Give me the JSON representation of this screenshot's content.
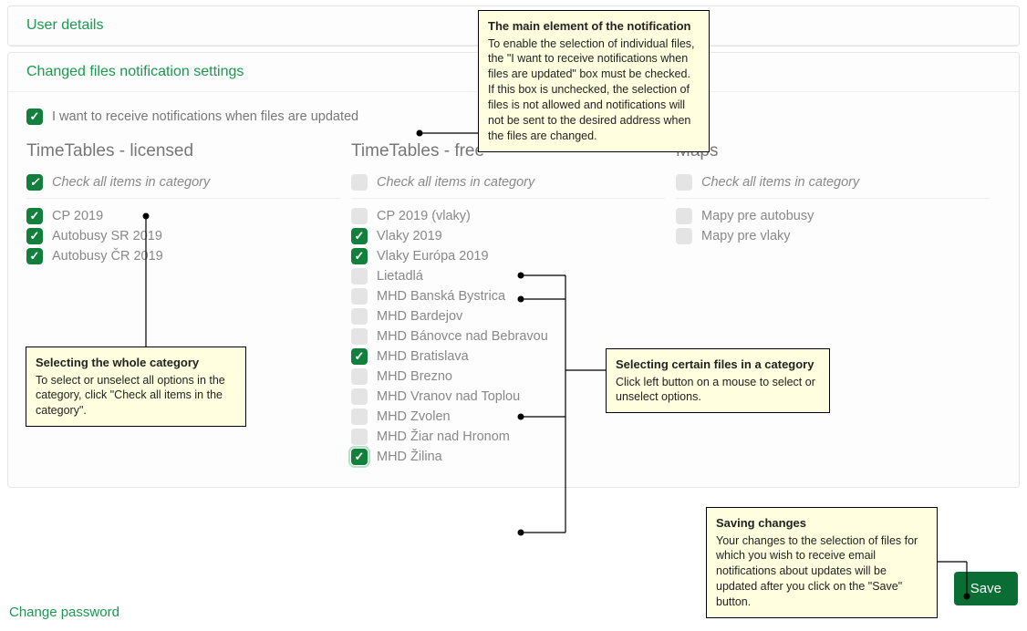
{
  "userDetails": {
    "title": "User details"
  },
  "settings": {
    "title": "Changed files notification settings",
    "mainCheckbox": {
      "label": "I want to receive notifications when files are updated",
      "checked": true
    }
  },
  "checkAllLabel": "Check all items in category",
  "columns": [
    {
      "title": "TimeTables - licensed",
      "checkAll": true,
      "items": [
        {
          "label": "CP 2019",
          "checked": true
        },
        {
          "label": "Autobusy SR 2019",
          "checked": true
        },
        {
          "label": "Autobusy ČR 2019",
          "checked": true
        }
      ]
    },
    {
      "title": "TimeTables - free",
      "checkAll": false,
      "items": [
        {
          "label": "CP 2019 (vlaky)",
          "checked": false
        },
        {
          "label": "Vlaky 2019",
          "checked": true
        },
        {
          "label": "Vlaky Európa 2019",
          "checked": true
        },
        {
          "label": "Lietadlá",
          "checked": false
        },
        {
          "label": "MHD Banská Bystrica",
          "checked": false
        },
        {
          "label": "MHD Bardejov",
          "checked": false
        },
        {
          "label": "MHD Bánovce nad Bebravou",
          "checked": false
        },
        {
          "label": "MHD Bratislava",
          "checked": true
        },
        {
          "label": "MHD Brezno",
          "checked": false
        },
        {
          "label": "MHD Vranov nad Toplou",
          "checked": false
        },
        {
          "label": "MHD Zvolen",
          "checked": false
        },
        {
          "label": "MHD Žiar nad Hronom",
          "checked": false
        },
        {
          "label": "MHD Žilina",
          "checked": true,
          "highlight": true
        }
      ]
    },
    {
      "title": "Maps",
      "checkAll": false,
      "items": [
        {
          "label": "Mapy pre autobusy",
          "checked": false
        },
        {
          "label": "Mapy pre vlaky",
          "checked": false
        }
      ]
    }
  ],
  "saveButton": "Save",
  "changePassword": "Change password",
  "callouts": {
    "main": {
      "title": "The main element of the notification",
      "body": "To enable the selection of individual files, the \"I want to receive notifications when files are updated\" box must be checked. If this box is unchecked, the selection of files is not allowed and notifications will not be sent to the desired address when the files are changed."
    },
    "wholeCategory": {
      "title": "Selecting the whole category",
      "body": "To select or unselect all options in the category, click \"Check all items in the category\"."
    },
    "certainFiles": {
      "title": "Selecting certain files in a category",
      "body": "Click left button on a mouse to select or unselect options."
    },
    "saving": {
      "title": "Saving changes",
      "body": "Your changes to the selection of files for which you wish to receive email notifications about updates will be updated after you click on the \"Save\" button."
    }
  }
}
